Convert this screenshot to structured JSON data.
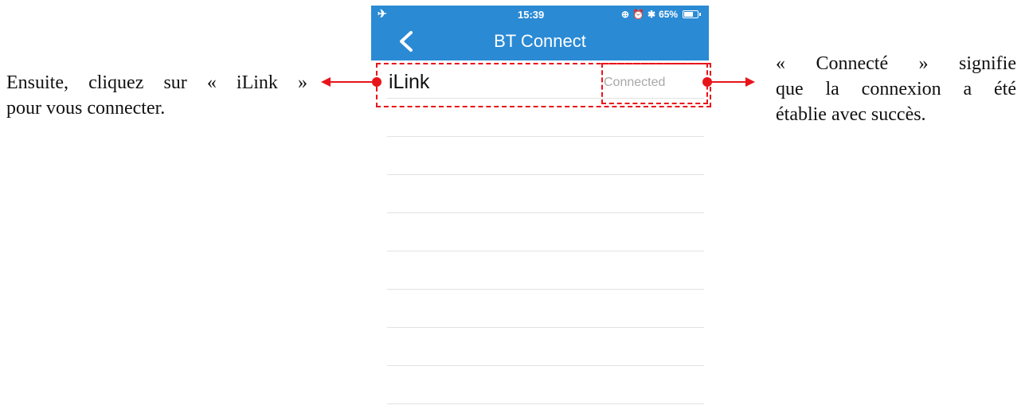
{
  "statusbar": {
    "time": "15:39",
    "icons": [
      "airplane-icon",
      "lock-rotation-icon",
      "alarm-icon",
      "bluetooth-icon",
      "battery-icon"
    ],
    "battery": "65%",
    "battery_level": 0.65
  },
  "navbar": {
    "title": "BT Connect",
    "back_icon": "chevron-left-icon",
    "background_color": "#2a8ad4"
  },
  "devices": [
    {
      "name": "iLink",
      "status": "Connected"
    }
  ],
  "annotations": {
    "left_line1": "Ensuite, cliquez sur « iLink »",
    "left_line2": "pour vous connecter.",
    "right_line1": "« Connecté » signifie",
    "right_line2": "que la connexion a été",
    "right_line3": "établie avec succès.",
    "highlight_color": "#e8141a"
  }
}
